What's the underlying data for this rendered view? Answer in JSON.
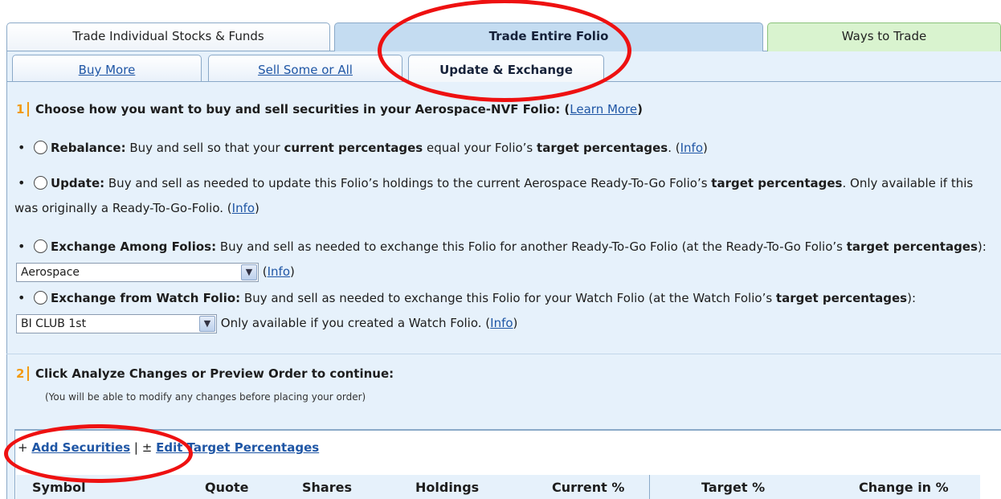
{
  "tabs": {
    "individual": "Trade Individual Stocks & Funds",
    "entire": "Trade Entire Folio",
    "ways": "Ways to Trade"
  },
  "subtabs": {
    "buy": "Buy More",
    "sell": "Sell Some or All",
    "update": "Update & Exchange"
  },
  "step1": {
    "number": "1",
    "text": "Choose how you want to buy and sell securities in your Aerospace-NVF Folio:",
    "learn_more": "Learn More"
  },
  "options": {
    "rebalance": {
      "title": "Rebalance:",
      "t1": " Buy and sell so that your ",
      "b1": "current percentages",
      "t2": " equal your Folio’s ",
      "b2": "target percentages",
      "t3": ". (",
      "info": "Info",
      "t4": ")"
    },
    "update": {
      "title": "Update:",
      "t1": " Buy and sell as needed to update this Folio’s holdings to the current Aerospace Ready-To-Go Folio’s ",
      "b1": "target percentages",
      "t2": ". Only available if this was originally a Ready-To-Go-Folio. (",
      "info": "Info",
      "t3": ")"
    },
    "exchange_among": {
      "title": "Exchange Among Folios:",
      "t1": " Buy and sell as needed to exchange this Folio for another Ready-To-Go Folio (at the Ready-To-Go Folio’s ",
      "b1": "target percentages",
      "t2": "): ",
      "select": "Aerospace",
      "info": "Info"
    },
    "exchange_watch": {
      "title": "Exchange from Watch Folio:",
      "t1": " Buy and sell as needed to exchange this Folio for your Watch Folio (at the Watch Folio’s ",
      "b1": "target percentages",
      "t2": "): ",
      "select": "BI CLUB 1st",
      "t3": " Only available if you created a Watch Folio. (",
      "info": "Info",
      "t4": ")"
    }
  },
  "step2": {
    "number": "2",
    "text": "Click Analyze Changes or Preview Order to continue:",
    "note": "(You will be able to modify any changes before placing your order)"
  },
  "toolbar": {
    "add_prefix": "+ ",
    "add": "Add Securities",
    "sep": " | ",
    "edit_prefix": "± ",
    "edit": "Edit Target Percentages"
  },
  "table": {
    "headers": [
      "Symbol",
      "Quote",
      "Shares",
      "Holdings",
      "Current %",
      "Target %",
      "Change in %"
    ]
  },
  "colors": {
    "annotation": "#ee1111",
    "link": "#1f56a5",
    "step_number": "#f29a12",
    "panel": "#e6f1fb"
  }
}
